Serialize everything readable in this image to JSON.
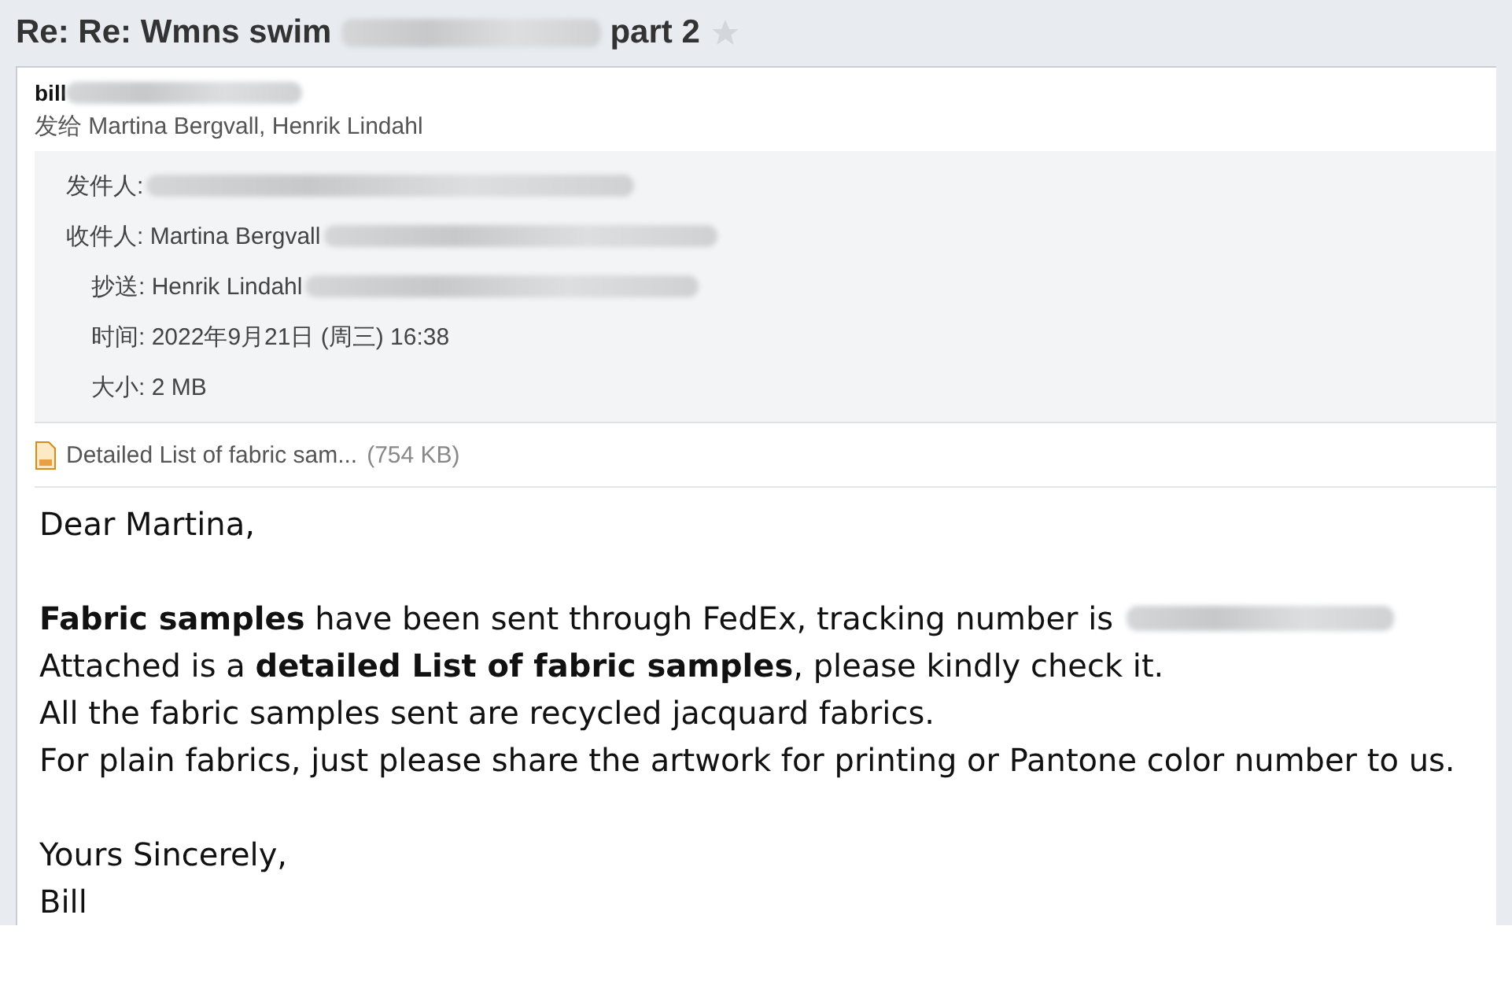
{
  "subject": {
    "before": "Re: Re: Wmns swim",
    "after": "part 2",
    "starred": false
  },
  "sender": {
    "name": "bill",
    "recipients_label": "发给",
    "recipients": "Martina Bergvall, Henrik Lindahl"
  },
  "details": [
    {
      "label": "发件人:",
      "redacted": true
    },
    {
      "label": "收件人:",
      "value": "Martina Bergvall",
      "redacted": true
    },
    {
      "label": "抄送:",
      "value": "Henrik Lindahl",
      "redacted": true
    },
    {
      "label": "时间:",
      "value": "2022年9月21日 (周三) 16:38",
      "redacted": false
    },
    {
      "label": "大小:",
      "value": "2 MB",
      "redacted": false
    }
  ],
  "attachment": {
    "name": "Detailed List of fabric sam...",
    "size": "(754 KB)"
  },
  "body": [
    [
      {
        "text": "Dear Martina,",
        "redacted_tail": false
      }
    ],
    [
      {
        "text": "**Fabric samples** have been sent through FedEx, tracking number is",
        "redacted_tail": true
      },
      {
        "text": "Attached is a **detailed List of fabric samples**, please kindly check it.",
        "redacted_tail": false
      },
      {
        "text": "All the fabric samples sent are recycled jacquard fabrics.",
        "redacted_tail": false
      },
      {
        "text": "For plain fabrics, just please share the artwork for printing or Pantone color number to us.",
        "redacted_tail": false
      }
    ],
    [
      {
        "text": "Yours Sincerely,",
        "redacted_tail": false
      },
      {
        "text": "Bill",
        "redacted_tail": false
      }
    ]
  ]
}
